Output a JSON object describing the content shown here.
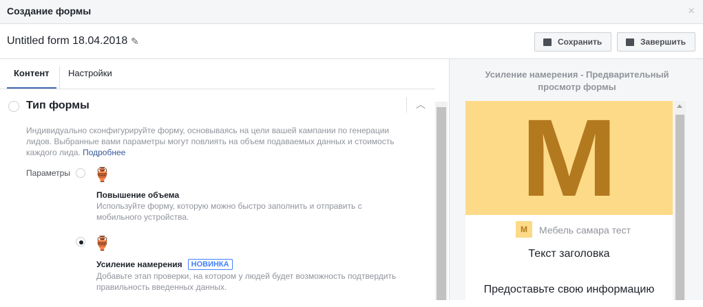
{
  "header": {
    "title": "Создание формы",
    "close": "×"
  },
  "form": {
    "name": "Untitled form 18.04.2018",
    "edit_icon": "pencil-icon"
  },
  "toolbar": {
    "save": "Сохранить",
    "finish": "Завершить"
  },
  "tabs": [
    {
      "label": "Контент",
      "active": true
    },
    {
      "label": "Настройки",
      "active": false
    }
  ],
  "section": {
    "title": "Тип формы",
    "description": "Индивидуально сконфигурируйте форму, основываясь на цели вашей кампании по генерации лидов. Выбранные вами параметры могут повлиять на объем подаваемых данных и стоимость каждого лида.",
    "learn_more": "Подробнее",
    "params_label": "Параметры",
    "options": [
      {
        "title": "Повышение объема",
        "desc": "Используйте форму, которую можно быстро заполнить и отправить с мобильного устройства.",
        "selected": false
      },
      {
        "title": "Усиление намерения",
        "badge": "НОВИНКА",
        "desc": "Добавьте этап проверки, на котором у людей будет возможность подтвердить правильность введенных данных.",
        "selected": true
      }
    ]
  },
  "preview": {
    "title": "Усиление намерения - Предварительный просмотр формы",
    "logo_letter": "M",
    "page_name": "Мебель самара тест",
    "headline": "Текст заголовка",
    "body": "Предоставьте свою информацию",
    "banner_color": "#fcda88",
    "letter_color": "#b2791f"
  }
}
